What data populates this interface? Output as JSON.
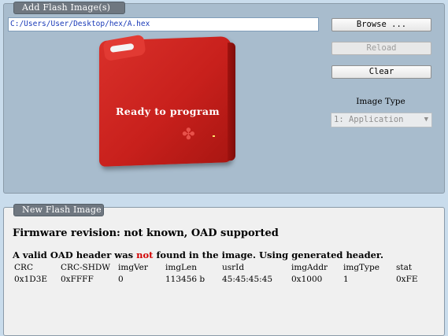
{
  "flash_panel": {
    "title": "Add Flash Image(s)",
    "file_path": "C:/Users/User/Desktop/hex/A.hex",
    "buttons": {
      "browse": "Browse ...",
      "reload": "Reload",
      "clear": "Clear"
    },
    "device_status": "Ready to program",
    "image_type_label": "Image Type",
    "image_type_value": "1: Application"
  },
  "info_panel": {
    "title": "New Flash Image",
    "firmware_line": "Firmware revision: not known, OAD supported",
    "oad_msg_part1": "A valid OAD header was ",
    "oad_msg_neg": "not",
    "oad_msg_part2": " found in the image. Using generated header.",
    "columns": [
      "CRC",
      "CRC-SHDW",
      "imgVer",
      "imgLen",
      "usrId",
      "imgAddr",
      "imgType",
      "stat"
    ],
    "values": [
      "0x1D3E",
      "0xFFFF",
      "0",
      "113456 b",
      "45:45:45:45",
      "0x1000",
      "1",
      "0xFE"
    ]
  },
  "colors": {
    "device_red": "#c8201c",
    "path_text": "#1a3ab8",
    "negation": "#d10000"
  },
  "icons": [
    "ti-logo-icon",
    "dropdown-arrow-icon"
  ]
}
